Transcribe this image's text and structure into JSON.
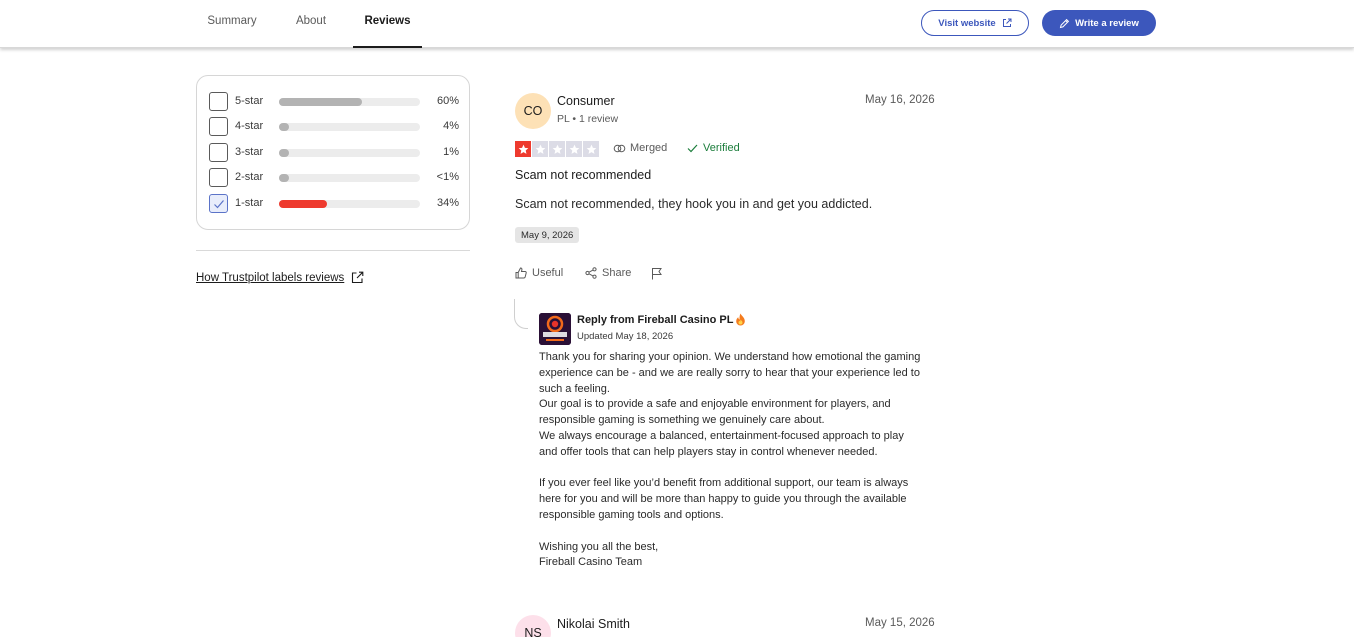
{
  "nav": {
    "tabs": [
      {
        "label": "Summary"
      },
      {
        "label": "About"
      },
      {
        "label": "Reviews"
      }
    ],
    "visit_label": "Visit website",
    "write_label": "Write a review"
  },
  "filters": {
    "rows": [
      {
        "label": "5-star",
        "percent_text": "60%",
        "fill_fraction": 0.6,
        "checked": false
      },
      {
        "label": "4-star",
        "percent_text": "4%",
        "fill_fraction": 0.04,
        "checked": false
      },
      {
        "label": "3-star",
        "percent_text": "1%",
        "fill_fraction": 0.01,
        "checked": false
      },
      {
        "label": "2-star",
        "percent_text": "<1%",
        "fill_fraction": 0.005,
        "checked": false
      },
      {
        "label": "1-star",
        "percent_text": "34%",
        "fill_fraction": 0.34,
        "checked": true
      }
    ],
    "how_label": "How Trustpilot labels reviews"
  },
  "reviews": [
    {
      "initials": "CO",
      "name": "Consumer",
      "meta": "PL • 1 review",
      "date": "May 16, 2026",
      "rating": 1,
      "merged_label": "Merged",
      "verified_label": "Verified",
      "title": "Scam not recommended",
      "body": "Scam not recommended, they hook you in and get you addicted.",
      "experience_date": "May 9, 2026",
      "useful_label": "Useful",
      "share_label": "Share",
      "reply": {
        "from": "Reply from Fireball Casino PL",
        "updated": "Updated May 18, 2026",
        "lines": [
          "Thank you for sharing your opinion. We understand how emotional the gaming",
          "experience can be - and we are really sorry to hear that your experience led to",
          "such a feeling.",
          "Our goal is to provide a safe and enjoyable environment for players, and",
          "responsible gaming is something we genuinely care about.",
          "We always encourage a balanced, entertainment-focused approach to play",
          "and offer tools that can help players stay in control whenever needed.",
          "",
          "If you ever feel like you’d benefit from additional support, our team is always",
          "here for you and will be more than happy to guide you through the available",
          "responsible gaming tools and options.",
          "",
          "Wishing you all the best,",
          "Fireball Casino Team"
        ]
      }
    },
    {
      "initials": "NS",
      "name": "Nikolai Smith",
      "date": "May 15, 2026"
    }
  ],
  "colors": {
    "accent": "#3c57bc",
    "one_star_red": "#ee3a2e",
    "verified_green": "#1b7d3b"
  }
}
